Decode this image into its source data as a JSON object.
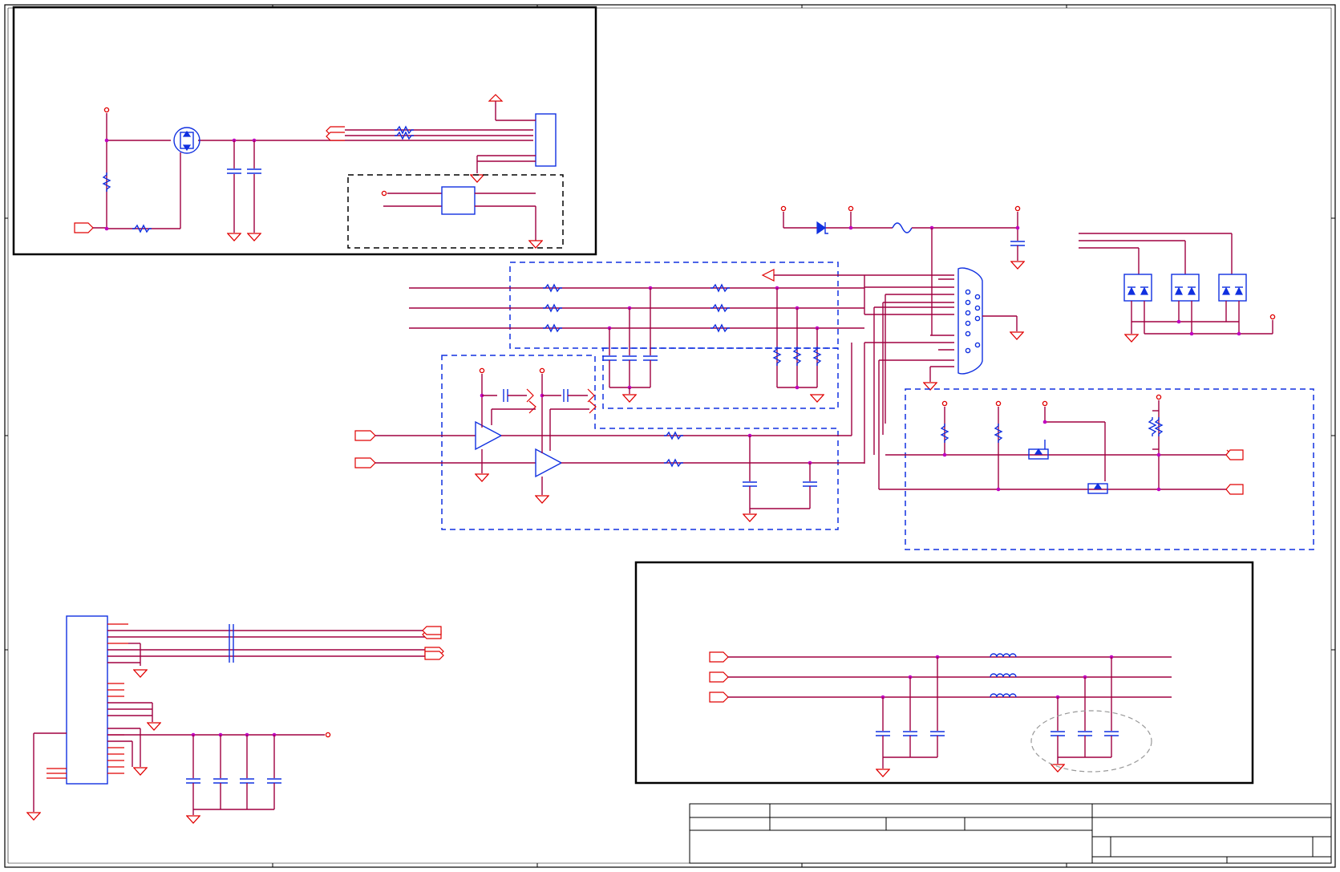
{
  "colors": {
    "wire": "#a00040",
    "pin": "#e00000",
    "component": "#1030e0",
    "junction": "#c000c0",
    "border": "#000000",
    "highlight": "#999999"
  },
  "sheet": {
    "page_count": 1,
    "title_block_filled": false
  },
  "components": {
    "resistors": 21,
    "capacitors": 19,
    "inductors": 3,
    "op_amps": 2,
    "mosfets": 3,
    "tvs_arrays": 3,
    "connectors": [
      "D-sub",
      "header-left",
      "header-top"
    ],
    "fuse": 1,
    "diode": 1
  },
  "icons": [
    "resistor-icon",
    "capacitor-icon",
    "ground-icon",
    "op-amp-icon",
    "mosfet-icon",
    "d-sub-connector-icon",
    "inductor-icon",
    "fuse-icon",
    "diode-icon",
    "port-icon"
  ]
}
